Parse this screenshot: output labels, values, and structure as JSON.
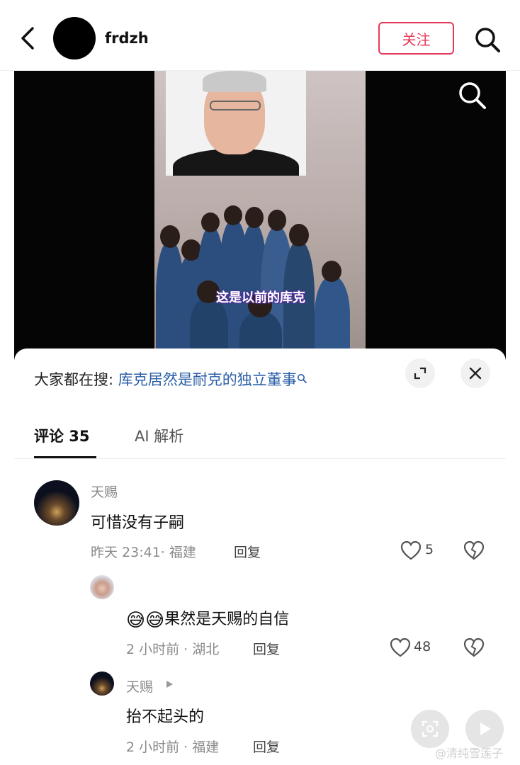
{
  "header": {
    "username": "frdzh",
    "follow_label": "关注",
    "icons": [
      "chevron-left-icon",
      "search-icon"
    ]
  },
  "video": {
    "subtitle": "这是以前的库克",
    "icons": [
      "search-icon"
    ]
  },
  "panel": {
    "suggest_prefix": "大家都在搜: ",
    "suggest_query": "库克居然是耐克的独立董事",
    "icons": [
      "search-small-icon",
      "collapse-icon",
      "close-icon"
    ]
  },
  "tabs": {
    "comments": "评论 35",
    "ai": "AI 解析"
  },
  "comments": [
    {
      "name": "天赐",
      "text": "可惜没有子嗣",
      "meta": "昨天 23:41· 福建",
      "reply_label": "回复",
      "likes": "5"
    },
    {
      "name": "",
      "text": "果然是天赐的自信",
      "emoji": "😅😅",
      "meta": "2 小时前 · 湖北",
      "reply_label": "回复",
      "likes": "48"
    },
    {
      "name": "天赐",
      "text": "抬不起头的",
      "meta": "2 小时前 · 福建",
      "reply_label": "回复"
    }
  ],
  "watermark": "@清纯雪莲子",
  "colors": {
    "accent": "#e53a57",
    "link": "#2b5fa8",
    "subtitle_outline": "#5a2fa0"
  }
}
